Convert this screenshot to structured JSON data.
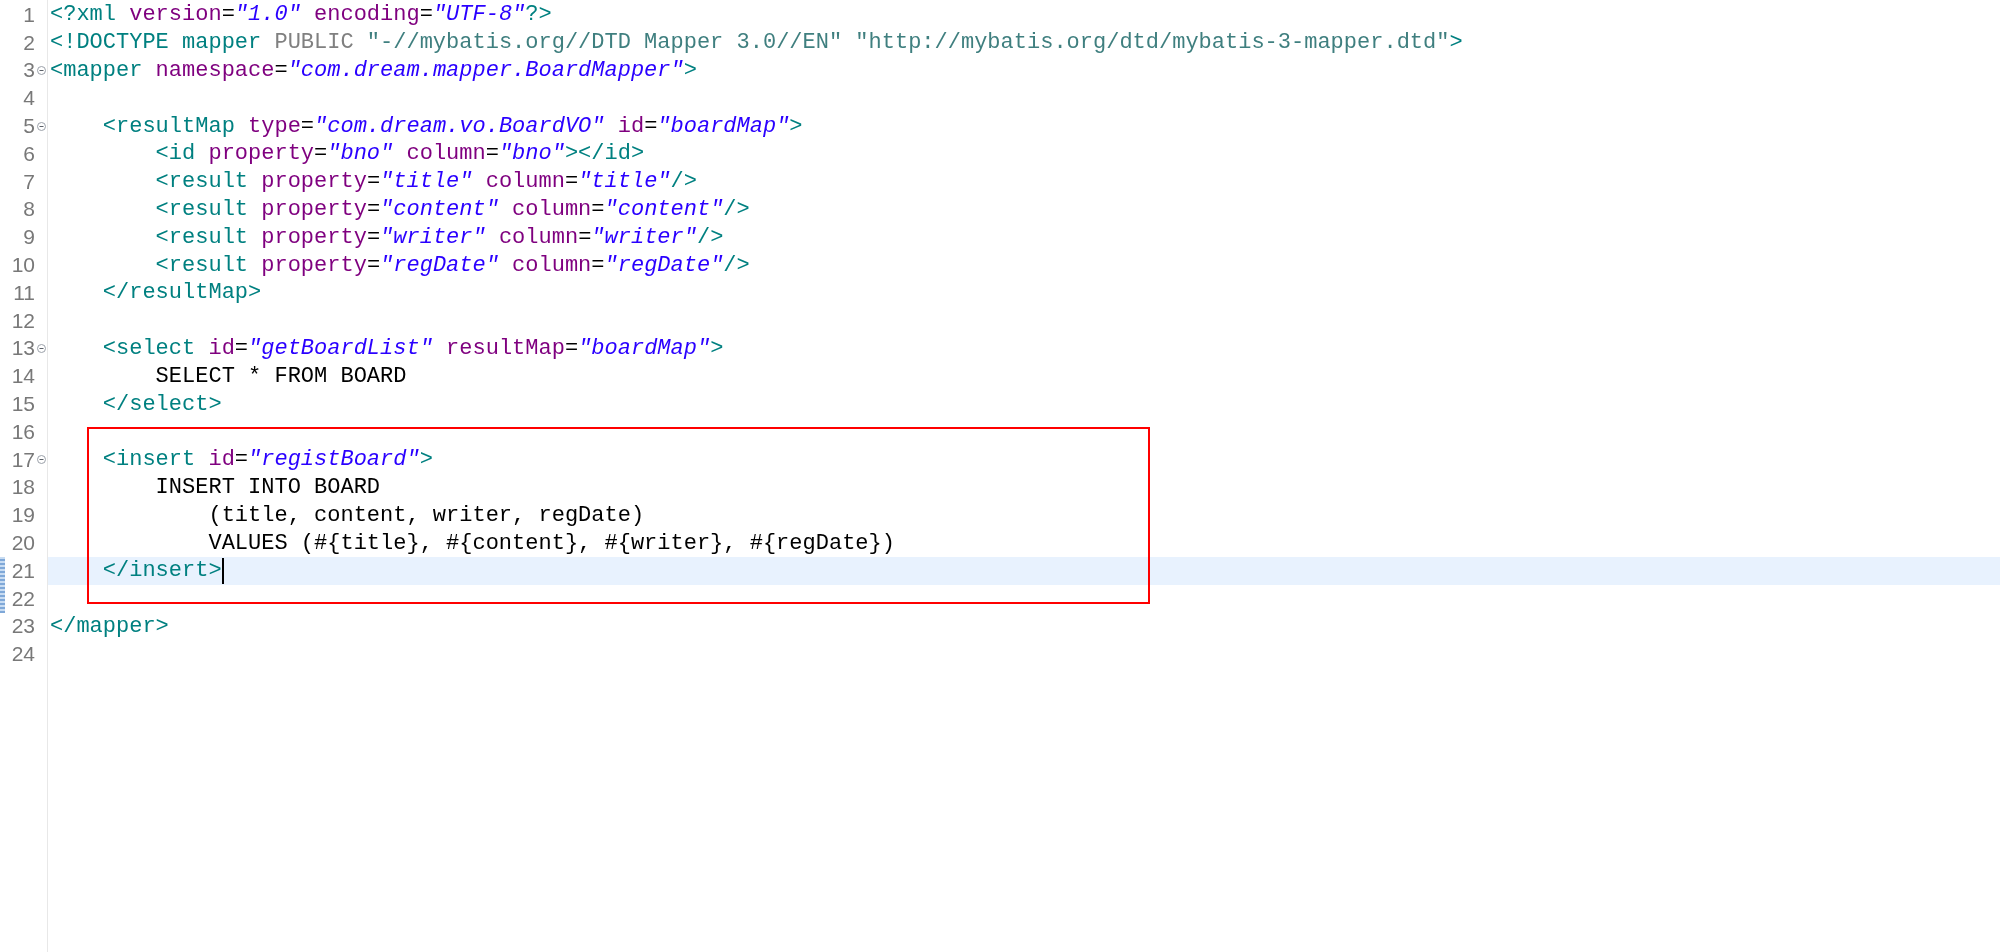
{
  "editor": {
    "sections": [
      {
        "boxed": false,
        "lines": [
          {
            "number": "1",
            "foldable": false,
            "current": false,
            "changed": false,
            "caret": false,
            "tokens": [
              {
                "kind": "tag",
                "text": "<?xml"
              },
              {
                "kind": "attr",
                "text": " version"
              },
              {
                "kind": "eq",
                "text": "="
              },
              {
                "kind": "value",
                "text": "\"1.0\""
              },
              {
                "kind": "attr",
                "text": " encoding"
              },
              {
                "kind": "eq",
                "text": "="
              },
              {
                "kind": "value",
                "text": "\"UTF-8\""
              },
              {
                "kind": "tag",
                "text": "?>"
              }
            ]
          },
          {
            "number": "2",
            "foldable": false,
            "current": false,
            "changed": false,
            "caret": false,
            "tokens": [
              {
                "kind": "tag",
                "text": "<!DOCTYPE mapper"
              },
              {
                "kind": "keyword",
                "text": " PUBLIC"
              },
              {
                "kind": "string",
                "text": " \"-//mybatis.org//DTD Mapper 3.0//EN\""
              },
              {
                "kind": "string",
                "text": " \"http://mybatis.org/dtd/mybatis-3-mapper.dtd\""
              },
              {
                "kind": "tag",
                "text": ">"
              }
            ]
          },
          {
            "number": "3",
            "foldable": true,
            "current": false,
            "changed": false,
            "caret": false,
            "tokens": [
              {
                "kind": "tag",
                "text": "<mapper"
              },
              {
                "kind": "attr",
                "text": " namespace"
              },
              {
                "kind": "eq",
                "text": "="
              },
              {
                "kind": "value",
                "text": "\"com.dream.mapper.BoardMapper\""
              },
              {
                "kind": "tag",
                "text": ">"
              }
            ]
          },
          {
            "number": "4",
            "foldable": false,
            "current": false,
            "changed": false,
            "caret": false
          },
          {
            "number": "5",
            "foldable": true,
            "current": false,
            "changed": false,
            "caret": false,
            "tokens": [
              {
                "kind": "tag",
                "text": "    <resultMap"
              },
              {
                "kind": "attr",
                "text": " type"
              },
              {
                "kind": "eq",
                "text": "="
              },
              {
                "kind": "value",
                "text": "\"com.dream.vo.BoardVO\""
              },
              {
                "kind": "attr",
                "text": " id"
              },
              {
                "kind": "eq",
                "text": "="
              },
              {
                "kind": "value",
                "text": "\"boardMap\""
              },
              {
                "kind": "tag",
                "text": ">"
              }
            ]
          },
          {
            "number": "6",
            "foldable": false,
            "current": false,
            "changed": false,
            "caret": false,
            "tokens": [
              {
                "kind": "tag",
                "text": "        <id"
              },
              {
                "kind": "attr",
                "text": " property"
              },
              {
                "kind": "eq",
                "text": "="
              },
              {
                "kind": "value",
                "text": "\"bno\""
              },
              {
                "kind": "attr",
                "text": " column"
              },
              {
                "kind": "eq",
                "text": "="
              },
              {
                "kind": "value",
                "text": "\"bno\""
              },
              {
                "kind": "tag",
                "text": "></id>"
              }
            ]
          },
          {
            "number": "7",
            "foldable": false,
            "current": false,
            "changed": false,
            "caret": false,
            "tokens": [
              {
                "kind": "tag",
                "text": "        <result"
              },
              {
                "kind": "attr",
                "text": " property"
              },
              {
                "kind": "eq",
                "text": "="
              },
              {
                "kind": "value",
                "text": "\"title\""
              },
              {
                "kind": "attr",
                "text": " column"
              },
              {
                "kind": "eq",
                "text": "="
              },
              {
                "kind": "value",
                "text": "\"title\""
              },
              {
                "kind": "tag",
                "text": "/>"
              }
            ]
          },
          {
            "number": "8",
            "foldable": false,
            "current": false,
            "changed": false,
            "caret": false,
            "tokens": [
              {
                "kind": "tag",
                "text": "        <result"
              },
              {
                "kind": "attr",
                "text": " property"
              },
              {
                "kind": "eq",
                "text": "="
              },
              {
                "kind": "value",
                "text": "\"content\""
              },
              {
                "kind": "attr",
                "text": " column"
              },
              {
                "kind": "eq",
                "text": "="
              },
              {
                "kind": "value",
                "text": "\"content\""
              },
              {
                "kind": "tag",
                "text": "/>"
              }
            ]
          },
          {
            "number": "9",
            "foldable": false,
            "current": false,
            "changed": false,
            "caret": false,
            "tokens": [
              {
                "kind": "tag",
                "text": "        <result"
              },
              {
                "kind": "attr",
                "text": " property"
              },
              {
                "kind": "eq",
                "text": "="
              },
              {
                "kind": "value",
                "text": "\"writer\""
              },
              {
                "kind": "attr",
                "text": " column"
              },
              {
                "kind": "eq",
                "text": "="
              },
              {
                "kind": "value",
                "text": "\"writer\""
              },
              {
                "kind": "tag",
                "text": "/>"
              }
            ]
          },
          {
            "number": "10",
            "foldable": false,
            "current": false,
            "changed": false,
            "caret": false,
            "tokens": [
              {
                "kind": "tag",
                "text": "        <result"
              },
              {
                "kind": "attr",
                "text": " property"
              },
              {
                "kind": "eq",
                "text": "="
              },
              {
                "kind": "value",
                "text": "\"regDate\""
              },
              {
                "kind": "attr",
                "text": " column"
              },
              {
                "kind": "eq",
                "text": "="
              },
              {
                "kind": "value",
                "text": "\"regDate\""
              },
              {
                "kind": "tag",
                "text": "/>"
              }
            ]
          },
          {
            "number": "11",
            "foldable": false,
            "current": false,
            "changed": false,
            "caret": false,
            "tokens": [
              {
                "kind": "tag",
                "text": "    </resultMap>"
              }
            ]
          },
          {
            "number": "12",
            "foldable": false,
            "current": false,
            "changed": false,
            "caret": false
          },
          {
            "number": "13",
            "foldable": true,
            "current": false,
            "changed": false,
            "caret": false,
            "tokens": [
              {
                "kind": "tag",
                "text": "    <select"
              },
              {
                "kind": "attr",
                "text": " id"
              },
              {
                "kind": "eq",
                "text": "="
              },
              {
                "kind": "value",
                "text": "\"getBoardList\""
              },
              {
                "kind": "attr",
                "text": " resultMap"
              },
              {
                "kind": "eq",
                "text": "="
              },
              {
                "kind": "value",
                "text": "\"boardMap\""
              },
              {
                "kind": "tag",
                "text": ">"
              }
            ]
          },
          {
            "number": "14",
            "foldable": false,
            "current": false,
            "changed": false,
            "caret": false,
            "tokens": [
              {
                "kind": "text",
                "text": "        SELECT * FROM BOARD"
              }
            ]
          },
          {
            "number": "15",
            "foldable": false,
            "current": false,
            "changed": false,
            "caret": false,
            "tokens": [
              {
                "kind": "tag",
                "text": "    </select>"
              }
            ]
          },
          {
            "number": "16",
            "foldable": false,
            "current": false,
            "changed": false,
            "caret": false
          }
        ]
      },
      {
        "boxed": true,
        "lines": [
          {
            "number": "17",
            "foldable": true,
            "current": false,
            "changed": false,
            "caret": false,
            "tokens": [
              {
                "kind": "tag",
                "text": "    <insert"
              },
              {
                "kind": "attr",
                "text": " id"
              },
              {
                "kind": "eq",
                "text": "="
              },
              {
                "kind": "value",
                "text": "\"registBoard\""
              },
              {
                "kind": "tag",
                "text": ">"
              }
            ]
          },
          {
            "number": "18",
            "foldable": false,
            "current": false,
            "changed": false,
            "caret": false,
            "tokens": [
              {
                "kind": "text",
                "text": "        INSERT INTO BOARD"
              }
            ]
          },
          {
            "number": "19",
            "foldable": false,
            "current": false,
            "changed": false,
            "caret": false,
            "tokens": [
              {
                "kind": "text",
                "text": "            (title, content, writer, regDate)"
              }
            ]
          },
          {
            "number": "20",
            "foldable": false,
            "current": false,
            "changed": false,
            "caret": false,
            "tokens": [
              {
                "kind": "text",
                "text": "            VALUES (#{title}, #{content}, #{writer}, #{regDate})"
              }
            ]
          },
          {
            "number": "21",
            "foldable": false,
            "current": true,
            "changed": true,
            "caret": true,
            "tokens": [
              {
                "kind": "tag",
                "text": "    </insert>"
              }
            ]
          },
          {
            "number": "22",
            "foldable": false,
            "current": false,
            "changed": true,
            "caret": false
          }
        ]
      },
      {
        "boxed": false,
        "lines": [
          {
            "number": "23",
            "foldable": false,
            "current": false,
            "changed": false,
            "caret": false,
            "tokens": [
              {
                "kind": "tag",
                "text": "</mapper>"
              }
            ]
          },
          {
            "number": "24",
            "foldable": false,
            "current": false,
            "changed": false,
            "caret": false
          }
        ]
      }
    ]
  }
}
